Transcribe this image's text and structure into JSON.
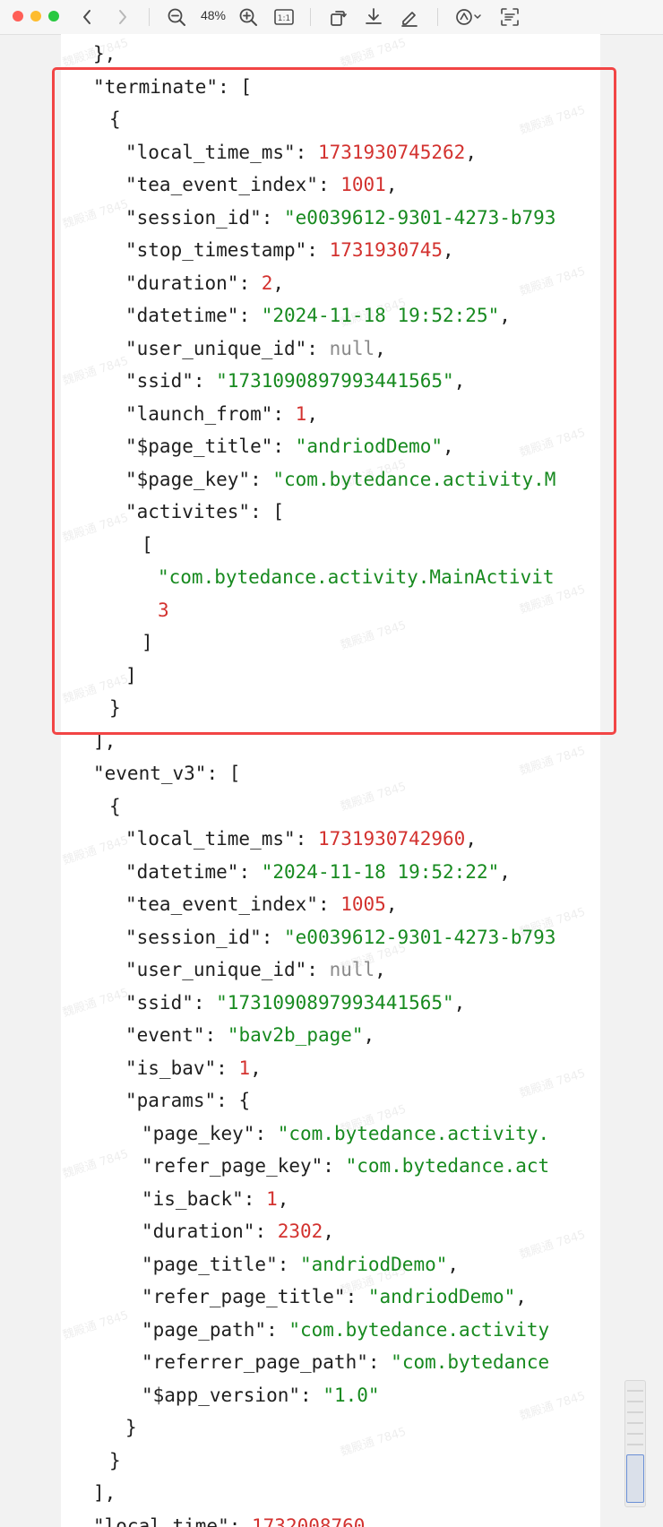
{
  "toolbar": {
    "zoom": "48%",
    "actual_size_label": "1:1"
  },
  "watermark_text": "魏殿通 7845",
  "code_lines": [
    {
      "indent": 2,
      "parts": [
        {
          "t": "p",
          "v": "},"
        }
      ]
    },
    {
      "indent": 2,
      "parts": [
        {
          "t": "k",
          "v": "\"terminate\""
        },
        {
          "t": "p",
          "v": ": ["
        }
      ]
    },
    {
      "indent": 3,
      "parts": [
        {
          "t": "p",
          "v": "{"
        }
      ]
    },
    {
      "indent": 4,
      "parts": [
        {
          "t": "k",
          "v": "\"local_time_ms\""
        },
        {
          "t": "p",
          "v": ": "
        },
        {
          "t": "n",
          "v": "1731930745262"
        },
        {
          "t": "p",
          "v": ","
        }
      ]
    },
    {
      "indent": 4,
      "parts": [
        {
          "t": "k",
          "v": "\"tea_event_index\""
        },
        {
          "t": "p",
          "v": ": "
        },
        {
          "t": "n",
          "v": "1001"
        },
        {
          "t": "p",
          "v": ","
        }
      ]
    },
    {
      "indent": 4,
      "parts": [
        {
          "t": "k",
          "v": "\"session_id\""
        },
        {
          "t": "p",
          "v": ": "
        },
        {
          "t": "s",
          "v": "\"e0039612-9301-4273-b793"
        }
      ]
    },
    {
      "indent": 4,
      "parts": [
        {
          "t": "k",
          "v": "\"stop_timestamp\""
        },
        {
          "t": "p",
          "v": ": "
        },
        {
          "t": "n",
          "v": "1731930745"
        },
        {
          "t": "p",
          "v": ","
        }
      ]
    },
    {
      "indent": 4,
      "parts": [
        {
          "t": "k",
          "v": "\"duration\""
        },
        {
          "t": "p",
          "v": ": "
        },
        {
          "t": "n",
          "v": "2"
        },
        {
          "t": "p",
          "v": ","
        }
      ]
    },
    {
      "indent": 4,
      "parts": [
        {
          "t": "k",
          "v": "\"datetime\""
        },
        {
          "t": "p",
          "v": ": "
        },
        {
          "t": "s",
          "v": "\"2024-11-18 19:52:25\""
        },
        {
          "t": "p",
          "v": ","
        }
      ]
    },
    {
      "indent": 4,
      "parts": [
        {
          "t": "k",
          "v": "\"user_unique_id\""
        },
        {
          "t": "p",
          "v": ": "
        },
        {
          "t": "l",
          "v": "null"
        },
        {
          "t": "p",
          "v": ","
        }
      ]
    },
    {
      "indent": 4,
      "parts": [
        {
          "t": "k",
          "v": "\"ssid\""
        },
        {
          "t": "p",
          "v": ": "
        },
        {
          "t": "s",
          "v": "\"1731090897993441565\""
        },
        {
          "t": "p",
          "v": ","
        }
      ]
    },
    {
      "indent": 4,
      "parts": [
        {
          "t": "k",
          "v": "\"launch_from\""
        },
        {
          "t": "p",
          "v": ": "
        },
        {
          "t": "n",
          "v": "1"
        },
        {
          "t": "p",
          "v": ","
        }
      ]
    },
    {
      "indent": 4,
      "parts": [
        {
          "t": "k",
          "v": "\"$page_title\""
        },
        {
          "t": "p",
          "v": ": "
        },
        {
          "t": "s",
          "v": "\"andriodDemo\""
        },
        {
          "t": "p",
          "v": ","
        }
      ]
    },
    {
      "indent": 4,
      "parts": [
        {
          "t": "k",
          "v": "\"$page_key\""
        },
        {
          "t": "p",
          "v": ": "
        },
        {
          "t": "s",
          "v": "\"com.bytedance.activity.M"
        }
      ]
    },
    {
      "indent": 4,
      "parts": [
        {
          "t": "k",
          "v": "\"activites\""
        },
        {
          "t": "p",
          "v": ": ["
        }
      ]
    },
    {
      "indent": 5,
      "parts": [
        {
          "t": "p",
          "v": "["
        }
      ]
    },
    {
      "indent": 6,
      "parts": [
        {
          "t": "s",
          "v": "\"com.bytedance.activity.MainActivit"
        }
      ]
    },
    {
      "indent": 6,
      "parts": [
        {
          "t": "n",
          "v": "3"
        }
      ]
    },
    {
      "indent": 5,
      "parts": [
        {
          "t": "p",
          "v": "]"
        }
      ]
    },
    {
      "indent": 4,
      "parts": [
        {
          "t": "p",
          "v": "]"
        }
      ]
    },
    {
      "indent": 3,
      "parts": [
        {
          "t": "p",
          "v": "}"
        }
      ]
    },
    {
      "indent": 2,
      "parts": [
        {
          "t": "p",
          "v": "],"
        }
      ]
    },
    {
      "indent": 2,
      "parts": [
        {
          "t": "k",
          "v": "\"event_v3\""
        },
        {
          "t": "p",
          "v": ": ["
        }
      ]
    },
    {
      "indent": 3,
      "parts": [
        {
          "t": "p",
          "v": "{"
        }
      ]
    },
    {
      "indent": 4,
      "parts": [
        {
          "t": "k",
          "v": "\"local_time_ms\""
        },
        {
          "t": "p",
          "v": ": "
        },
        {
          "t": "n",
          "v": "1731930742960"
        },
        {
          "t": "p",
          "v": ","
        }
      ]
    },
    {
      "indent": 4,
      "parts": [
        {
          "t": "k",
          "v": "\"datetime\""
        },
        {
          "t": "p",
          "v": ": "
        },
        {
          "t": "s",
          "v": "\"2024-11-18 19:52:22\""
        },
        {
          "t": "p",
          "v": ","
        }
      ]
    },
    {
      "indent": 4,
      "parts": [
        {
          "t": "k",
          "v": "\"tea_event_index\""
        },
        {
          "t": "p",
          "v": ": "
        },
        {
          "t": "n",
          "v": "1005"
        },
        {
          "t": "p",
          "v": ","
        }
      ]
    },
    {
      "indent": 4,
      "parts": [
        {
          "t": "k",
          "v": "\"session_id\""
        },
        {
          "t": "p",
          "v": ": "
        },
        {
          "t": "s",
          "v": "\"e0039612-9301-4273-b793"
        }
      ]
    },
    {
      "indent": 4,
      "parts": [
        {
          "t": "k",
          "v": "\"user_unique_id\""
        },
        {
          "t": "p",
          "v": ": "
        },
        {
          "t": "l",
          "v": "null"
        },
        {
          "t": "p",
          "v": ","
        }
      ]
    },
    {
      "indent": 4,
      "parts": [
        {
          "t": "k",
          "v": "\"ssid\""
        },
        {
          "t": "p",
          "v": ": "
        },
        {
          "t": "s",
          "v": "\"1731090897993441565\""
        },
        {
          "t": "p",
          "v": ","
        }
      ]
    },
    {
      "indent": 4,
      "parts": [
        {
          "t": "k",
          "v": "\"event\""
        },
        {
          "t": "p",
          "v": ": "
        },
        {
          "t": "s",
          "v": "\"bav2b_page\""
        },
        {
          "t": "p",
          "v": ","
        }
      ]
    },
    {
      "indent": 4,
      "parts": [
        {
          "t": "k",
          "v": "\"is_bav\""
        },
        {
          "t": "p",
          "v": ": "
        },
        {
          "t": "n",
          "v": "1"
        },
        {
          "t": "p",
          "v": ","
        }
      ]
    },
    {
      "indent": 4,
      "parts": [
        {
          "t": "k",
          "v": "\"params\""
        },
        {
          "t": "p",
          "v": ": {"
        }
      ]
    },
    {
      "indent": 5,
      "parts": [
        {
          "t": "k",
          "v": "\"page_key\""
        },
        {
          "t": "p",
          "v": ": "
        },
        {
          "t": "s",
          "v": "\"com.bytedance.activity."
        }
      ]
    },
    {
      "indent": 5,
      "parts": [
        {
          "t": "k",
          "v": "\"refer_page_key\""
        },
        {
          "t": "p",
          "v": ": "
        },
        {
          "t": "s",
          "v": "\"com.bytedance.act"
        }
      ]
    },
    {
      "indent": 5,
      "parts": [
        {
          "t": "k",
          "v": "\"is_back\""
        },
        {
          "t": "p",
          "v": ": "
        },
        {
          "t": "n",
          "v": "1"
        },
        {
          "t": "p",
          "v": ","
        }
      ]
    },
    {
      "indent": 5,
      "parts": [
        {
          "t": "k",
          "v": "\"duration\""
        },
        {
          "t": "p",
          "v": ": "
        },
        {
          "t": "n",
          "v": "2302"
        },
        {
          "t": "p",
          "v": ","
        }
      ]
    },
    {
      "indent": 5,
      "parts": [
        {
          "t": "k",
          "v": "\"page_title\""
        },
        {
          "t": "p",
          "v": ": "
        },
        {
          "t": "s",
          "v": "\"andriodDemo\""
        },
        {
          "t": "p",
          "v": ","
        }
      ]
    },
    {
      "indent": 5,
      "parts": [
        {
          "t": "k",
          "v": "\"refer_page_title\""
        },
        {
          "t": "p",
          "v": ": "
        },
        {
          "t": "s",
          "v": "\"andriodDemo\""
        },
        {
          "t": "p",
          "v": ","
        }
      ]
    },
    {
      "indent": 5,
      "parts": [
        {
          "t": "k",
          "v": "\"page_path\""
        },
        {
          "t": "p",
          "v": ": "
        },
        {
          "t": "s",
          "v": "\"com.bytedance.activity"
        }
      ]
    },
    {
      "indent": 5,
      "parts": [
        {
          "t": "k",
          "v": "\"referrer_page_path\""
        },
        {
          "t": "p",
          "v": ": "
        },
        {
          "t": "s",
          "v": "\"com.bytedance"
        }
      ]
    },
    {
      "indent": 5,
      "parts": [
        {
          "t": "k",
          "v": "\"$app_version\""
        },
        {
          "t": "p",
          "v": ": "
        },
        {
          "t": "s",
          "v": "\"1.0\""
        }
      ]
    },
    {
      "indent": 4,
      "parts": [
        {
          "t": "p",
          "v": "}"
        }
      ]
    },
    {
      "indent": 3,
      "parts": [
        {
          "t": "p",
          "v": "}"
        }
      ]
    },
    {
      "indent": 2,
      "parts": [
        {
          "t": "p",
          "v": "],"
        }
      ]
    },
    {
      "indent": 2,
      "parts": [
        {
          "t": "k",
          "v": "\"local_time\""
        },
        {
          "t": "p",
          "v": ": "
        },
        {
          "t": "n",
          "v": "1732008760"
        }
      ]
    }
  ]
}
